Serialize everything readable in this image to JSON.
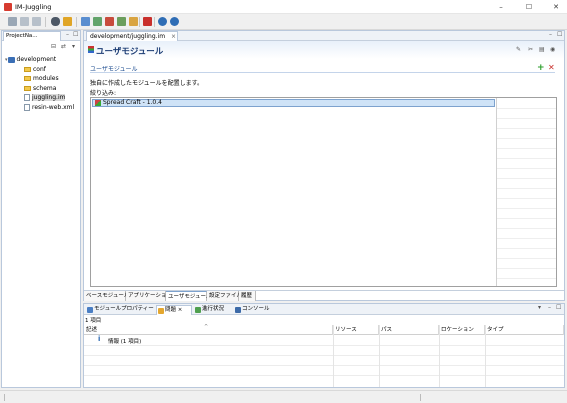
{
  "window": {
    "title": "IM-Juggling",
    "minimize": "–",
    "maximize": "☐",
    "close": "✕"
  },
  "colors": {
    "accent": "#1a3b73",
    "selection": "#cfe3f7"
  },
  "toolbar": {
    "icons": [
      "save-icon",
      "save-all-icon",
      "print-icon",
      "server-icon",
      "deploy-icon",
      "new-file-icon",
      "new-folder-icon",
      "upload-icon",
      "export-icon",
      "stop-icon",
      "help-icon",
      "info-icon"
    ]
  },
  "project_navigator": {
    "tab_label": "ProjectNa...",
    "tree": [
      {
        "label": "development",
        "type": "project",
        "depth": 0
      },
      {
        "label": "conf",
        "type": "folder",
        "depth": 1
      },
      {
        "label": "modules",
        "type": "folder",
        "depth": 1
      },
      {
        "label": "schema",
        "type": "folder",
        "depth": 1
      },
      {
        "label": "juggling.im",
        "type": "file",
        "depth": 1,
        "selected": true
      },
      {
        "label": "resin-web.xml",
        "type": "file",
        "depth": 1
      }
    ]
  },
  "editor": {
    "tab_label": "development/juggling.im",
    "form_title": "ユーザモジュール",
    "section_title": "ユーザモジュール",
    "description": "独自に作成したモジュールを配置します。",
    "filter_label": "絞り込み:",
    "modules": [
      {
        "name": "Spread Craft - 1.0.4",
        "selected": true
      }
    ],
    "bottom_tabs": [
      "ベースモジュール",
      "アプリケーション",
      "ユーザモジュール",
      "設定ファイル",
      "履歴"
    ],
    "active_bottom_tab": "ユーザモジュール"
  },
  "bottom_panel": {
    "tabs": [
      {
        "label": "モジュールプロパティー",
        "active": false
      },
      {
        "label": "問題 ⨯",
        "active": true
      },
      {
        "label": "進行状況",
        "active": false
      },
      {
        "label": "コンソール",
        "active": false
      }
    ],
    "items_count": "1 項目",
    "columns": [
      "記述",
      "リソース",
      "パス",
      "ロケーション",
      "タイプ"
    ],
    "rows": [
      {
        "description": "情報 (1 項目)",
        "resource": "",
        "path": "",
        "location": "",
        "type": ""
      }
    ]
  }
}
